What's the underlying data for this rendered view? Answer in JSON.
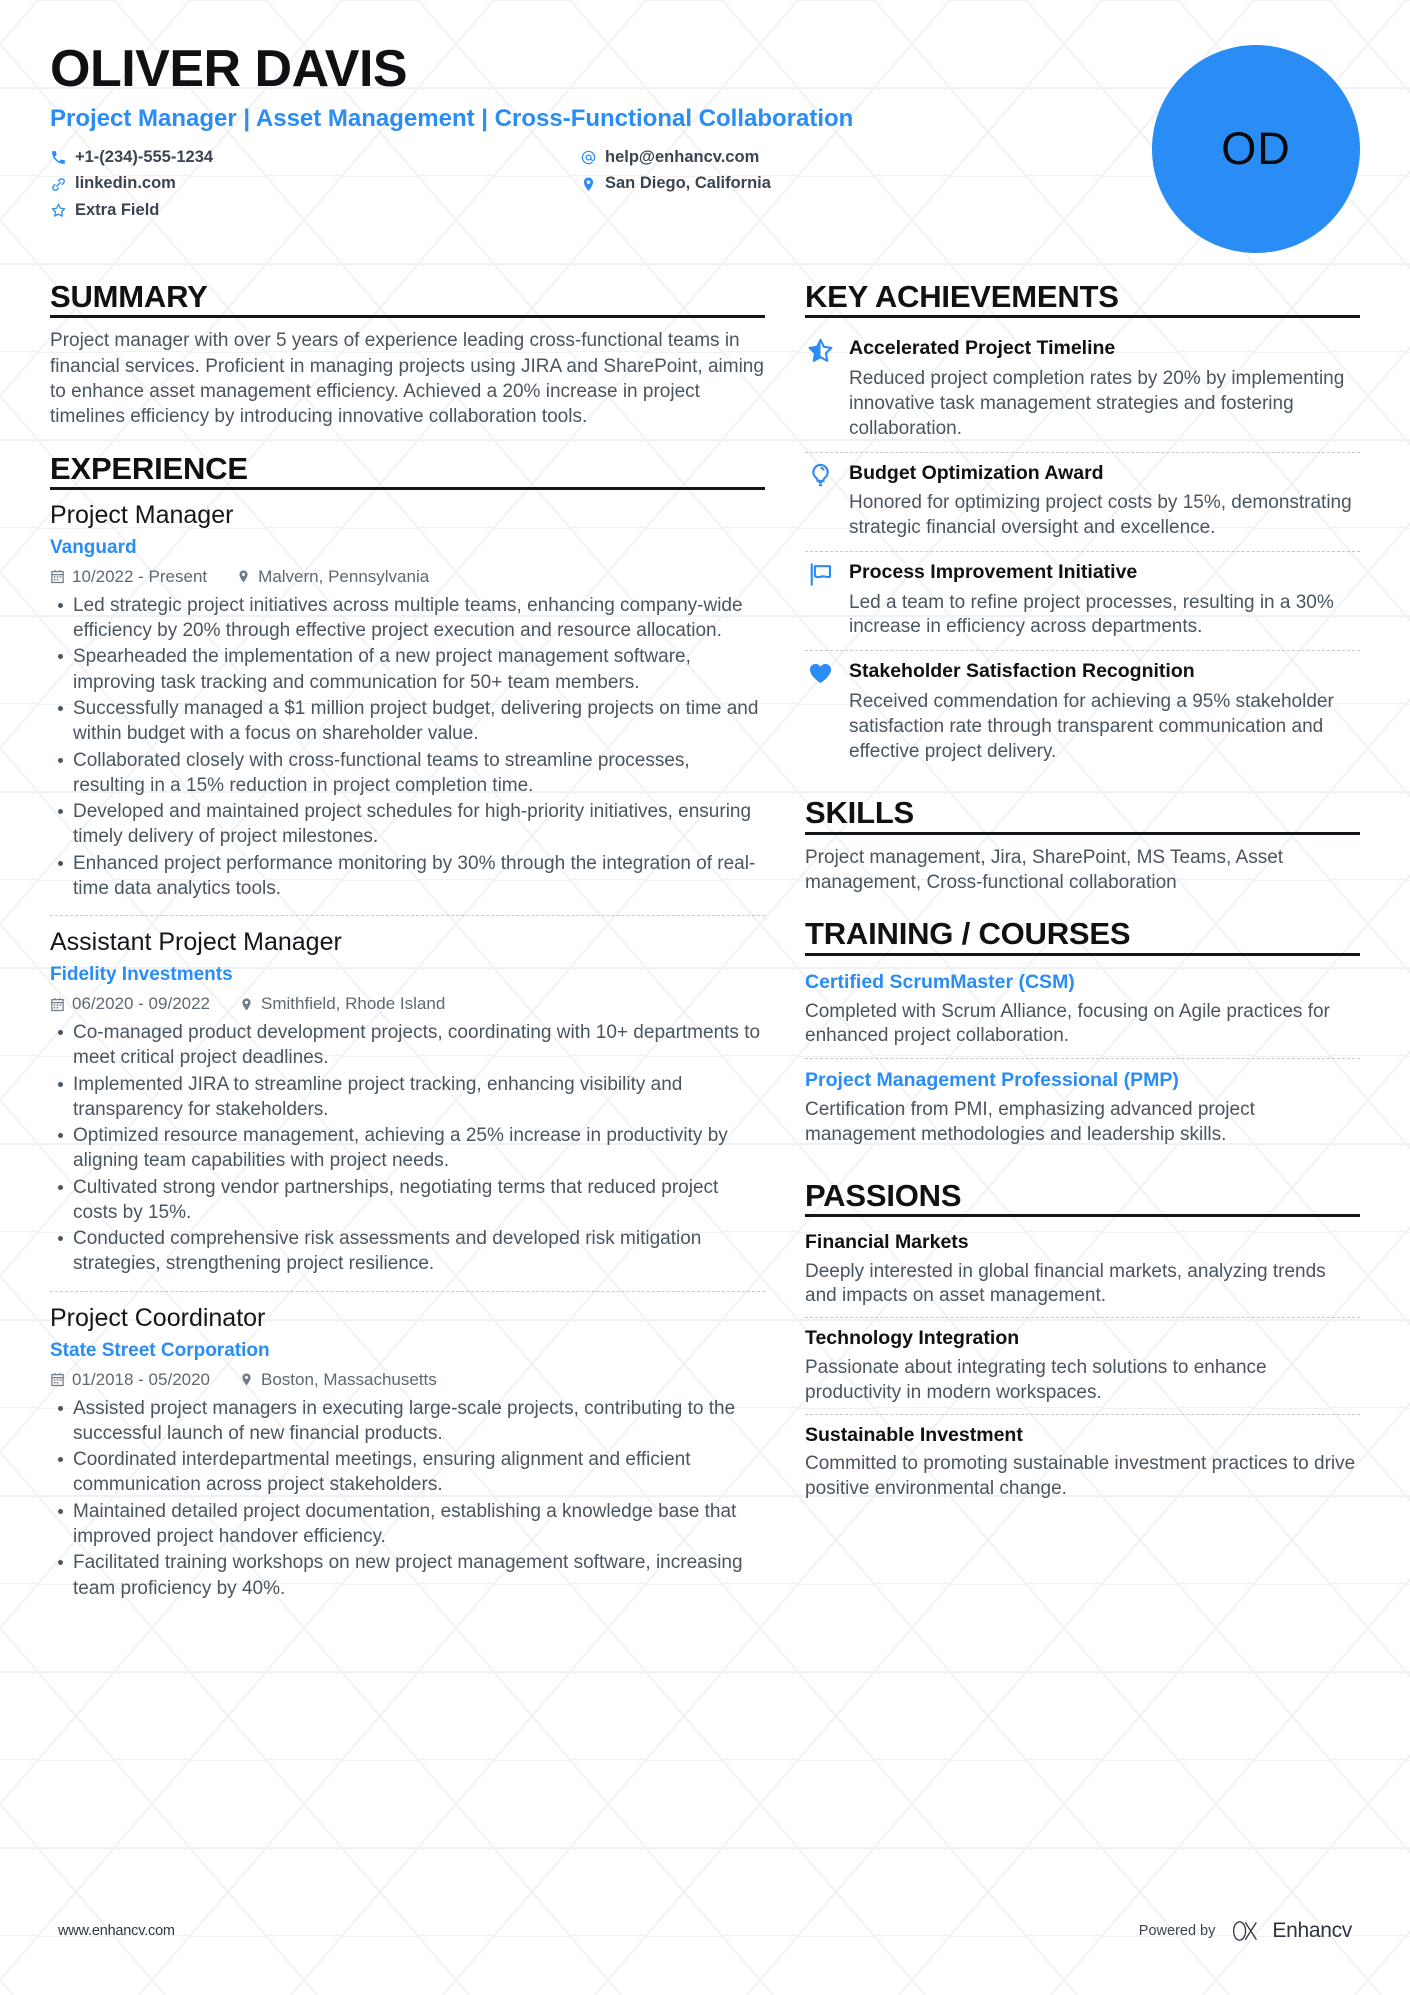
{
  "header": {
    "name": "OLIVER DAVIS",
    "headline": "Project Manager | Asset Management | Cross-Functional Collaboration",
    "avatar_initials": "OD",
    "accent_color": "#2a8cf5",
    "contacts_left": [
      {
        "icon": "phone-icon",
        "text": "+1-(234)-555-1234"
      },
      {
        "icon": "link-icon",
        "text": "linkedin.com"
      },
      {
        "icon": "star-icon",
        "text": "Extra Field"
      }
    ],
    "contacts_right": [
      {
        "icon": "at-icon",
        "text": "help@enhancv.com"
      },
      {
        "icon": "location-pin-icon",
        "text": "San Diego, California"
      }
    ]
  },
  "summary": {
    "title": "SUMMARY",
    "text": "Project manager with over 5 years of experience leading cross-functional teams in financial services. Proficient in managing projects using JIRA and SharePoint, aiming to enhance asset management efficiency. Achieved a 20% increase in project timelines efficiency by introducing innovative collaboration tools."
  },
  "experience": {
    "title": "EXPERIENCE",
    "jobs": [
      {
        "role": "Project Manager",
        "company": "Vanguard",
        "dates": "10/2022 - Present",
        "location": "Malvern, Pennsylvania",
        "bullets": [
          "Led strategic project initiatives across multiple teams, enhancing company-wide efficiency by 20% through effective project execution and resource allocation.",
          "Spearheaded the implementation of a new project management software, improving task tracking and communication for 50+ team members.",
          "Successfully managed a $1 million project budget, delivering projects on time and within budget with a focus on shareholder value.",
          "Collaborated closely with cross-functional teams to streamline processes, resulting in a 15% reduction in project completion time.",
          "Developed and maintained project schedules for high-priority initiatives, ensuring timely delivery of project milestones.",
          "Enhanced project performance monitoring by 30% through the integration of real-time data analytics tools."
        ]
      },
      {
        "role": "Assistant Project Manager",
        "company": "Fidelity Investments",
        "dates": "06/2020 - 09/2022",
        "location": "Smithfield, Rhode Island",
        "bullets": [
          "Co-managed product development projects, coordinating with 10+ departments to meet critical project deadlines.",
          "Implemented JIRA to streamline project tracking, enhancing visibility and transparency for stakeholders.",
          "Optimized resource management, achieving a 25% increase in productivity by aligning team capabilities with project needs.",
          "Cultivated strong vendor partnerships, negotiating terms that reduced project costs by 15%.",
          "Conducted comprehensive risk assessments and developed risk mitigation strategies, strengthening project resilience."
        ]
      },
      {
        "role": "Project Coordinator",
        "company": "State Street Corporation",
        "dates": "01/2018 - 05/2020",
        "location": "Boston, Massachusetts",
        "bullets": [
          "Assisted project managers in executing large-scale projects, contributing to the successful launch of new financial products.",
          "Coordinated interdepartmental meetings, ensuring alignment and efficient communication across project stakeholders.",
          "Maintained detailed project documentation, establishing a knowledge base that improved project handover efficiency.",
          "Facilitated training workshops on new project management software, increasing team proficiency by 40%."
        ]
      }
    ]
  },
  "key_achievements": {
    "title": "KEY ACHIEVEMENTS",
    "items": [
      {
        "icon": "star-outline-icon",
        "title": "Accelerated Project Timeline",
        "desc": "Reduced project completion rates by 20% by implementing innovative task management strategies and fostering collaboration."
      },
      {
        "icon": "lightbulb-icon",
        "title": "Budget Optimization Award",
        "desc": "Honored for optimizing project costs by 15%, demonstrating strategic financial oversight and excellence."
      },
      {
        "icon": "flag-icon",
        "title": "Process Improvement Initiative",
        "desc": "Led a team to refine project processes, resulting in a 30% increase in efficiency across departments."
      },
      {
        "icon": "heart-icon",
        "title": "Stakeholder Satisfaction Recognition",
        "desc": "Received commendation for achieving a 95% stakeholder satisfaction rate through transparent communication and effective project delivery."
      }
    ]
  },
  "skills": {
    "title": "SKILLS",
    "text": "Project management, Jira, SharePoint, MS Teams, Asset management, Cross-functional collaboration"
  },
  "training": {
    "title": "TRAINING / COURSES",
    "items": [
      {
        "title": "Certified ScrumMaster (CSM)",
        "desc": "Completed with Scrum Alliance, focusing on Agile practices for enhanced project collaboration."
      },
      {
        "title": "Project Management Professional (PMP)",
        "desc": "Certification from PMI, emphasizing advanced project management methodologies and leadership skills."
      }
    ]
  },
  "passions": {
    "title": "PASSIONS",
    "items": [
      {
        "title": "Financial Markets",
        "desc": "Deeply interested in global financial markets, analyzing trends and impacts on asset management."
      },
      {
        "title": "Technology Integration",
        "desc": "Passionate about integrating tech solutions to enhance productivity in modern workspaces."
      },
      {
        "title": "Sustainable Investment",
        "desc": "Committed to promoting sustainable investment practices to drive positive environmental change."
      }
    ]
  },
  "footer": {
    "url": "www.enhancv.com",
    "powered_by": "Powered by",
    "brand": "Enhancv"
  }
}
